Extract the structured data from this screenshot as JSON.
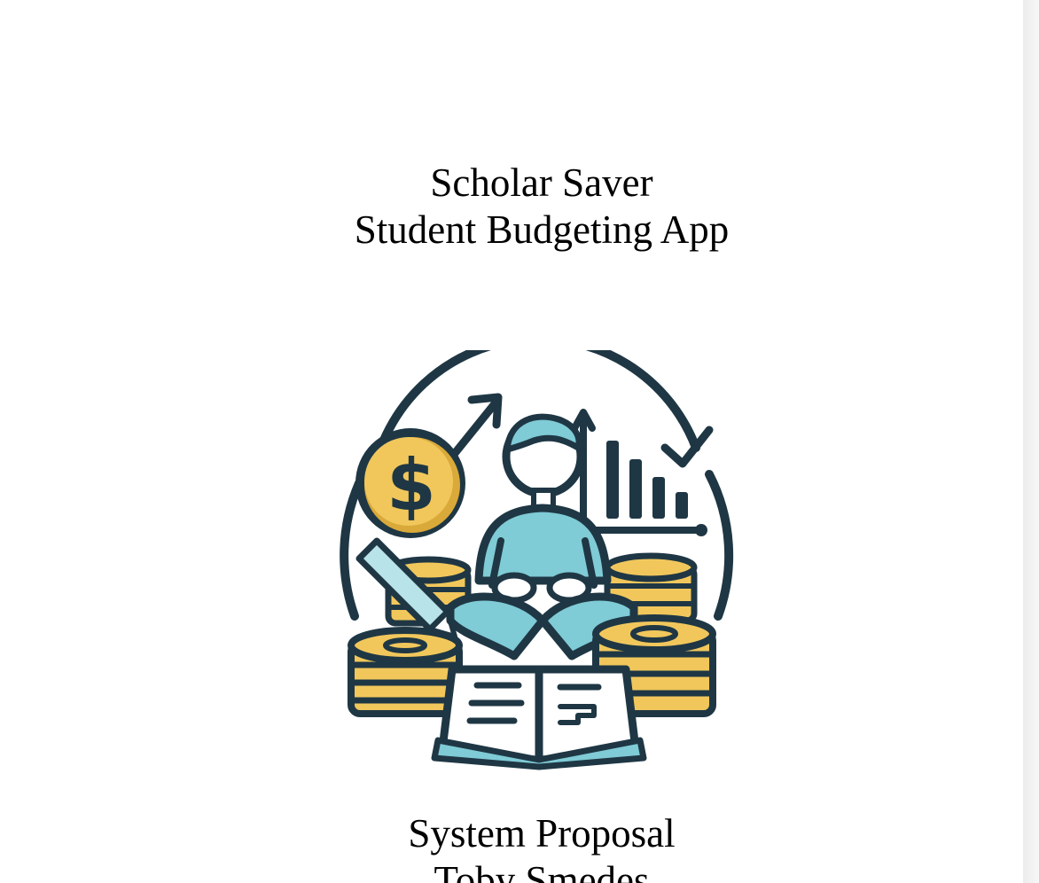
{
  "document": {
    "title_line_1": "Scholar Saver",
    "title_line_2": "Student Budgeting App",
    "subtitle_line_1": "System Proposal",
    "subtitle_line_2": "Toby Smedes"
  },
  "logo": {
    "icon": "student-budgeting-logo-icon",
    "coin_symbol": "$",
    "colors": {
      "outline": "#1f3744",
      "gold": "#f1c75c",
      "gold_dark": "#d9a93a",
      "teal": "#7fcbd6",
      "teal_light": "#b8e3e8"
    }
  }
}
